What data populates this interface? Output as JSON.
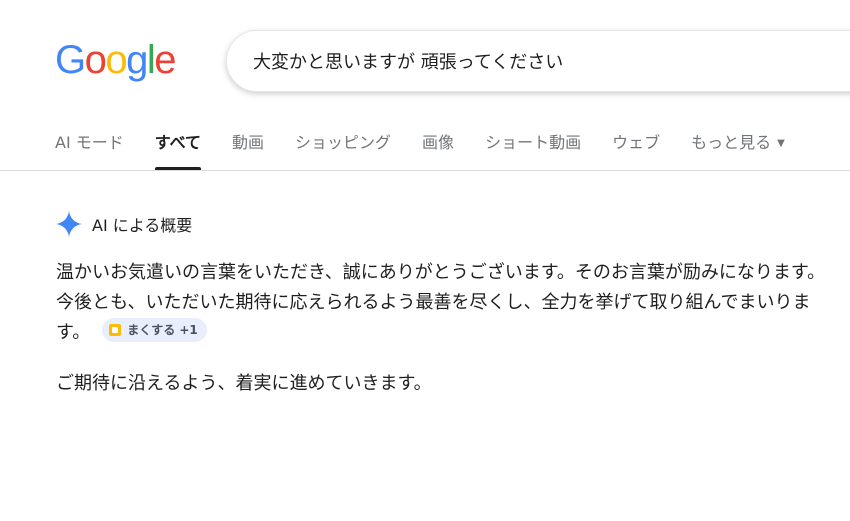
{
  "logo": {
    "letters": [
      "G",
      "o",
      "o",
      "g",
      "l",
      "e"
    ],
    "colors": [
      "#4285F4",
      "#EA4335",
      "#FBBC05",
      "#4285F4",
      "#34A853",
      "#EA4335"
    ]
  },
  "search": {
    "value": "大変かと思いますが 頑張ってください"
  },
  "tabs": [
    {
      "label": "AI モード"
    },
    {
      "label": "すべて",
      "active": true
    },
    {
      "label": "動画"
    },
    {
      "label": "ショッピング"
    },
    {
      "label": "画像"
    },
    {
      "label": "ショート動画"
    },
    {
      "label": "ウェブ"
    },
    {
      "label": "もっと見る"
    }
  ],
  "ai_overview": {
    "title": "AI による概要",
    "paragraph1": "温かいお気遣いの言葉をいただき、誠にありがとうございます。そのお言葉が励みになります。今後とも、いただいた期待に応えられるよう最善を尽くし、全力を挙げて取り組んでまいります。",
    "source_chip": "まくする +1",
    "paragraph2": "ご期待に沿えるよう、着実に進めていきます。"
  },
  "colors": {
    "accent": "#1f1f1f",
    "tab_inactive": "#70757a",
    "sparkle": "#4285F4",
    "chip_bg": "#e8eefb"
  }
}
